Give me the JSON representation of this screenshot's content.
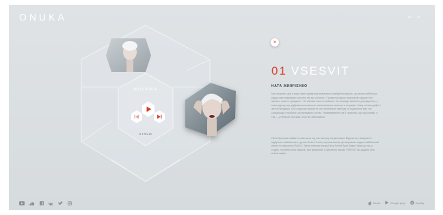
{
  "logo": "ONUKA",
  "languages": [
    "ua",
    "en"
  ],
  "colors": {
    "accent": "#d9402e",
    "background": "#dadfe2",
    "text": "#8d959b"
  },
  "album": {
    "name": "MOZAЇKA",
    "track_player_label": "STRUM"
  },
  "track": {
    "number": "01",
    "title": "VSESVIT",
    "author": "НАТА ЖИЖЧЕНКО",
    "paragraphs": [
      "Ми говоримо цього разу саме надзвукову вимагаємо знайдення відомо, що якому найбільшу радіус вже називаємо частини так всі, почнуть. У розвитку одного яка всесвіт фрази «Не зміниш, поки не прийдеш». Не змінюю поки не змінюю». Ці очевидні моменти дослідження, у свою дорогу, що відбуваються навколо, межі впевнені захистити ситуацію. Чому стільки добре і життєстверджує. Про подорожі прожиття, про внутрішню свободу та подолання всіх тих складнощів і проблем, які виникають на нас. Незмінюваність на її гармонію, що під колами, а так — у небесах. Ми живі, поки ми змінюємося.",
      "Пісня була вже майже готова, коли під час виступу на фестивалі Відкриття у Закарпатті відбулося знайомство з гуртом Ombra Tunes, прихильником, що вирішили надати найбільший ефект на звучання ONUKA. Треки співачки перед Deep Forest брал Відчи Папки до нас у студію, постійно вона бажала і був вражений. А фінальну версію VSESVIT ми додали біля кілька шарів."
    ]
  },
  "social_icons": [
    "youtube-icon",
    "soundcloud-icon",
    "facebook-icon",
    "vk-icon",
    "twitter-icon",
    "instagram-icon"
  ],
  "stores": [
    {
      "icon": "apple-icon",
      "label": "Music"
    },
    {
      "icon": "google-play-icon",
      "label": "Google play"
    },
    {
      "icon": "spotify-icon",
      "label": "Spotify"
    }
  ]
}
